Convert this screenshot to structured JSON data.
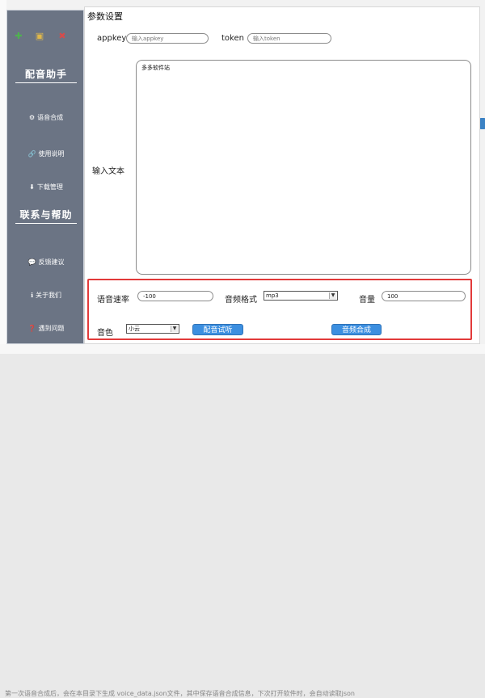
{
  "background": {
    "footer_text": "第一次语音合成后，会在本目录下生成 voice_data.json文件，其中保存语音合成信息，下次打开软件时，会自动读取json"
  },
  "sidebar": {
    "window_icons": [
      "minimize-icon",
      "maximize-icon",
      "close-icon"
    ],
    "section_titles": [
      "配音助手",
      "联系与帮助"
    ],
    "items": [
      {
        "label": "语音合成",
        "icon": "gear-icon"
      },
      {
        "label": "使用说明",
        "icon": "link-icon"
      },
      {
        "label": "下载管理",
        "icon": "download-icon"
      },
      {
        "label": "反馈建议",
        "icon": "chat-icon"
      },
      {
        "label": "关于我们",
        "icon": "info-icon"
      },
      {
        "label": "遇到问题",
        "icon": "question-icon"
      }
    ]
  },
  "panel": {
    "title": "参数设置",
    "appkey_label": "appkey",
    "appkey_placeholder": "输入appkey",
    "token_label": "token",
    "token_placeholder": "输入token",
    "input_label": "输入文本",
    "input_text": "多多软件站"
  },
  "settings": {
    "rate_label": "语音速率",
    "rate_value": "-100",
    "format_label": "音频格式",
    "format_value": "mp3",
    "volume_label": "音量",
    "volume_value": "100",
    "voice_label": "音色",
    "voice_value": "小云",
    "test_button": "配音试听",
    "synth_button": "音频合成"
  },
  "colors": {
    "sidebar_bg": "#586274",
    "highlight_border": "#e23a3a",
    "button_bg": "#3c8fe0"
  }
}
